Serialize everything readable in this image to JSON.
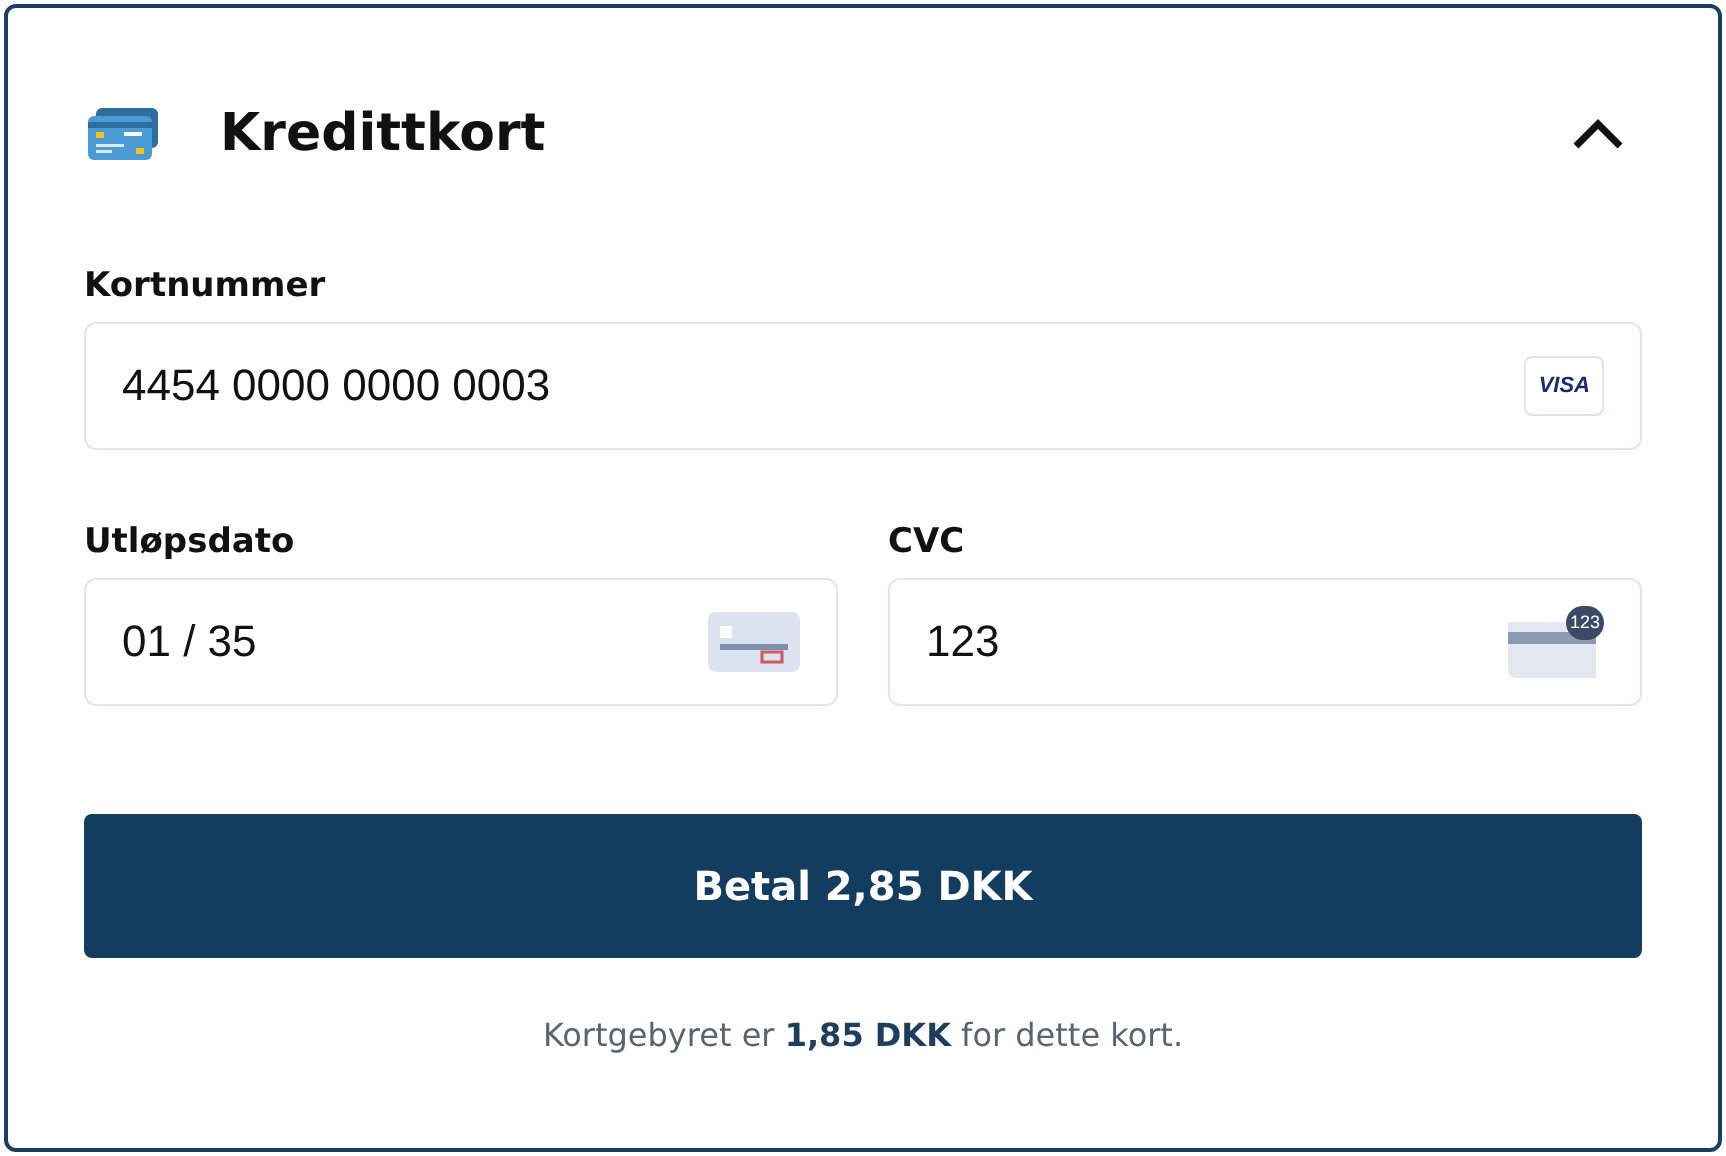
{
  "section": {
    "title": "Kredittkort",
    "expanded": true
  },
  "card_number": {
    "label": "Kortnummer",
    "value": "4454 0000 0000 0003",
    "brand": "VISA"
  },
  "expiry": {
    "label": "Utløpsdato",
    "value": "01 / 35"
  },
  "cvc": {
    "label": "CVC",
    "value": "123",
    "icon_text": "123"
  },
  "pay_button": "Betal 2,85 DKK",
  "fee_note": "Kortgebyret er **1,85 DKK** for dette kort."
}
